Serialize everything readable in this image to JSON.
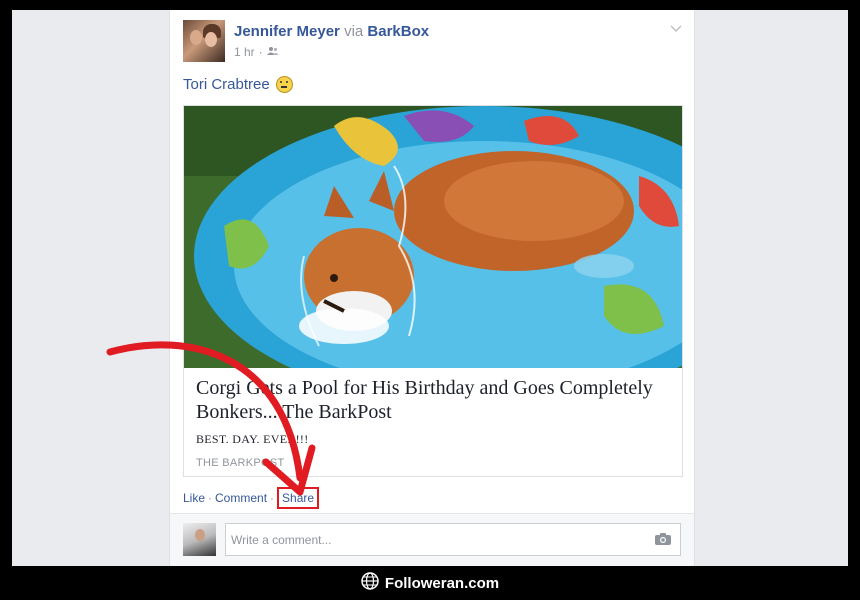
{
  "post": {
    "author": "Jennifer Meyer",
    "via_word": "via",
    "via_page": "BarkBox",
    "time": "1 hr",
    "meta_separator": "·",
    "text": "Tori Crabtree",
    "emoji_icon": "smiley-emoji-icon",
    "privacy_icon": "friends-icon",
    "menu_icon": "chevron-down-icon"
  },
  "link_card": {
    "title": "Corgi Gets a Pool for His Birthday and Goes Completely Bonkers... The BarkPost",
    "description": "BEST. DAY. EVER!!!",
    "source": "THE BARKPOST",
    "image": "corgi-in-kiddie-pool-photo"
  },
  "actions": {
    "like": "Like",
    "comment": "Comment",
    "share": "Share",
    "separator": "·",
    "highlight_color": "#e01b22"
  },
  "comment_box": {
    "placeholder": "Write a comment...",
    "camera_icon": "camera-icon"
  },
  "watermark": {
    "brand": "Followeran.com",
    "icon": "globe-icon"
  },
  "colors": {
    "link_blue": "#365899",
    "arrow_red": "#e01b22",
    "muted_gray": "#90949c"
  }
}
